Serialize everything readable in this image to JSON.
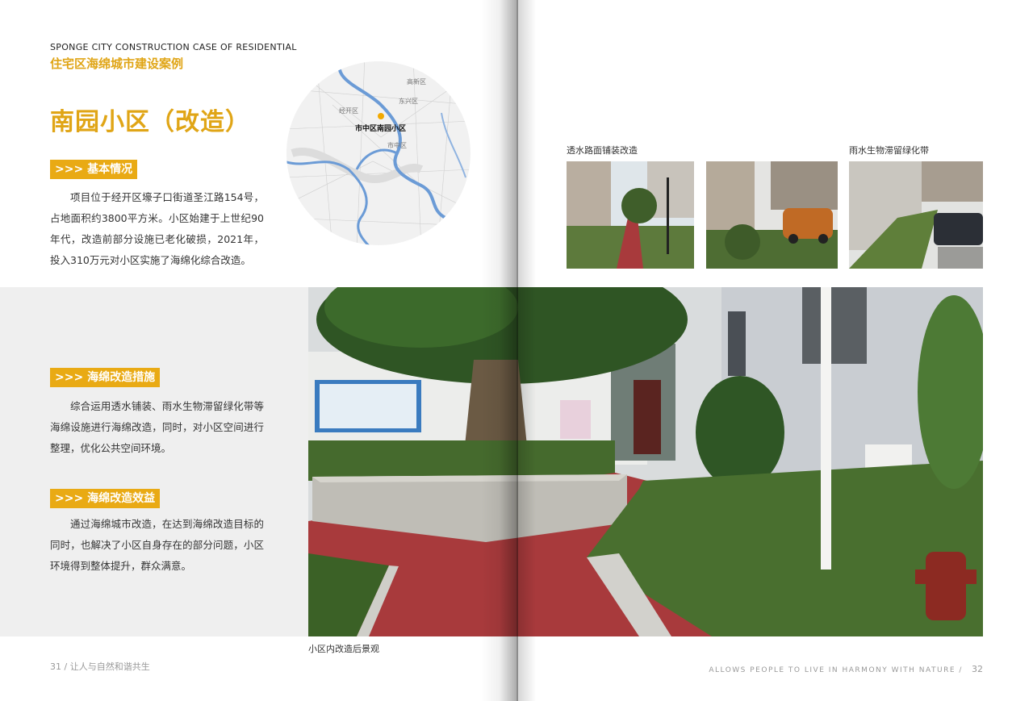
{
  "header": {
    "en_title": "SPONGE CITY CONSTRUCTION CASE  OF RESIDENTIAL",
    "cn_title": "住宅区海绵城市建设案例"
  },
  "project_title": "南园小区（改造）",
  "sections": {
    "basic": {
      "tag": ">>> 基本情况",
      "text": "项目位于经开区壕子口街道圣江路154号，占地面积约3800平方米。小区始建于上世纪90年代，改造前部分设施已老化破损，2021年，投入310万元对小区实施了海绵化综合改造。"
    },
    "measures": {
      "tag": ">>> 海绵改造措施",
      "text": "综合运用透水铺装、雨水生物滞留绿化带等海绵设施进行海绵改造，同时，对小区空间进行整理，优化公共空间环境。"
    },
    "benefits": {
      "tag": ">>> 海绵改造效益",
      "text": "通过海绵城市改造，在达到海绵改造目标的同时，也解决了小区自身存在的部分问题，小区环境得到整体提升，群众满意。"
    }
  },
  "map": {
    "labels": [
      "高新区",
      "东兴区",
      "经开区",
      "市中区"
    ],
    "highlight_label": "市中区南园小区",
    "marker_color": "#f2a900",
    "river_color": "#6b9bd6"
  },
  "captions": {
    "permeable_paving": "透水路面铺装改造",
    "bioretention": "雨水生物滞留绿化带",
    "main_photo": "小区内改造后景观"
  },
  "footer": {
    "left_page_number": "31",
    "left_text": "/  让人与自然和谐共生",
    "right_text": "ALLOWS PEOPLE TO LIVE IN HARMONY WITH NATURE /",
    "right_page_number": "32"
  },
  "colors": {
    "accent": "#e9aa14",
    "title": "#e0a516",
    "panel": "#efefef",
    "pavement": "#a83a3c"
  }
}
